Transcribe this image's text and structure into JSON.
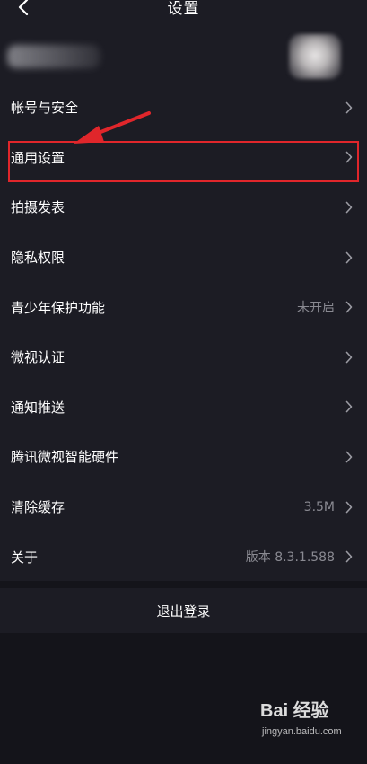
{
  "header": {
    "title": "设置"
  },
  "settings": {
    "items": [
      {
        "label": "帐号与安全",
        "value": ""
      },
      {
        "label": "通用设置",
        "value": ""
      },
      {
        "label": "拍摄发表",
        "value": ""
      },
      {
        "label": "隐私权限",
        "value": ""
      },
      {
        "label": "青少年保护功能",
        "value": "未开启"
      },
      {
        "label": "微视认证",
        "value": ""
      },
      {
        "label": "通知推送",
        "value": ""
      },
      {
        "label": "腾讯微视智能硬件",
        "value": ""
      },
      {
        "label": "清除缓存",
        "value": "3.5M"
      },
      {
        "label": "关于",
        "value": "版本 8.3.1.588"
      }
    ]
  },
  "logout": {
    "label": "退出登录"
  },
  "watermark": {
    "brand": "Bai 经验",
    "url": "jingyan.baidu.com"
  },
  "colors": {
    "background": "#1c1c24",
    "annotation": "#e0262b",
    "secondary_text": "#8a8a92"
  },
  "icons": {
    "back": "chevron-left-icon",
    "row_arrow": "chevron-right-icon"
  }
}
